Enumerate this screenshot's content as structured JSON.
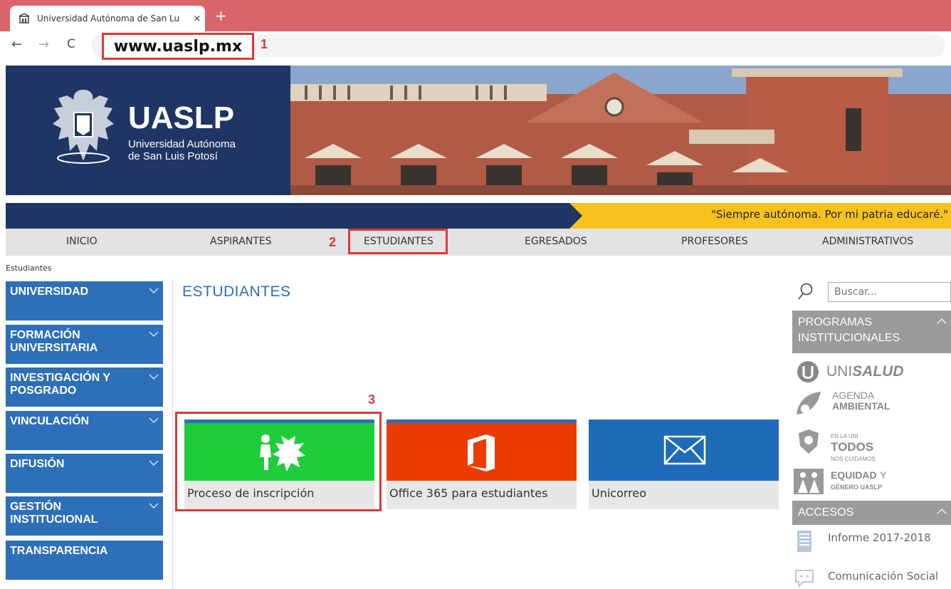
{
  "browser": {
    "tab_title": "Universidad Autónoma de San Lu",
    "close_glyph": "×",
    "new_tab_glyph": "+",
    "url": "www.uaslp.mx",
    "back_glyph": "←",
    "forward_glyph": "→",
    "reload_glyph": "C"
  },
  "annotations": {
    "one": "1",
    "two": "2",
    "three": "3",
    "color": "#d93a3a"
  },
  "header": {
    "logo_title": "UASLP",
    "logo_sub1": "Universidad Autónoma",
    "logo_sub2": "de San Luis Potosí",
    "slogan": "\"Siempre autónoma. Por mi patria educaré.\""
  },
  "nav": {
    "items": [
      "INICIO",
      "ASPIRANTES",
      "ESTUDIANTES",
      "EGRESADOS",
      "PROFESORES",
      "ADMINISTRATIVOS"
    ]
  },
  "breadcrumb": "Estudiantes",
  "sidebar": {
    "items": [
      "UNIVERSIDAD",
      "FORMACIÓN UNIVERSITARIA",
      "INVESTIGACIÓN Y POSGRADO",
      "VINCULACIÓN",
      "DIFUSIÓN",
      "GESTIÓN INSTITUCIONAL",
      "TRANSPARENCIA"
    ]
  },
  "main": {
    "title": "ESTUDIANTES",
    "tiles": [
      {
        "label": "Proceso de inscripción",
        "color": "#1fcc3a",
        "icon": "inscription-icon"
      },
      {
        "label": "Office 365 para estudiantes",
        "color": "#eb3c00",
        "icon": "office-icon"
      },
      {
        "label": "Unicorreo",
        "color": "#1e6bb8",
        "icon": "mail-icon"
      }
    ]
  },
  "right": {
    "search_placeholder": "Buscar...",
    "programas_header": "PROGRAMAS INSTITUCIONALES",
    "unisalud_uni": "UNI",
    "unisalud_salud": "SALUD",
    "agenda_1": "AGENDA",
    "agenda_2": "AMBIENTAL",
    "todos_1": "EN LA UNI",
    "todos_2": "TODOS",
    "todos_3": "NOS CUIDAMOS",
    "equidad_1": "EQUIDAD",
    "equidad_y": "Y",
    "equidad_2": "GÉNERO UASLP",
    "accesos_header": "ACCESOS",
    "accesos": [
      "Informe 2017-2018",
      "Comunicación Social"
    ]
  },
  "colors": {
    "navy": "#1f3563",
    "accent_blue": "#2d6fb8",
    "yellow": "#f7c21e",
    "tab_bar": "#d9656a"
  }
}
